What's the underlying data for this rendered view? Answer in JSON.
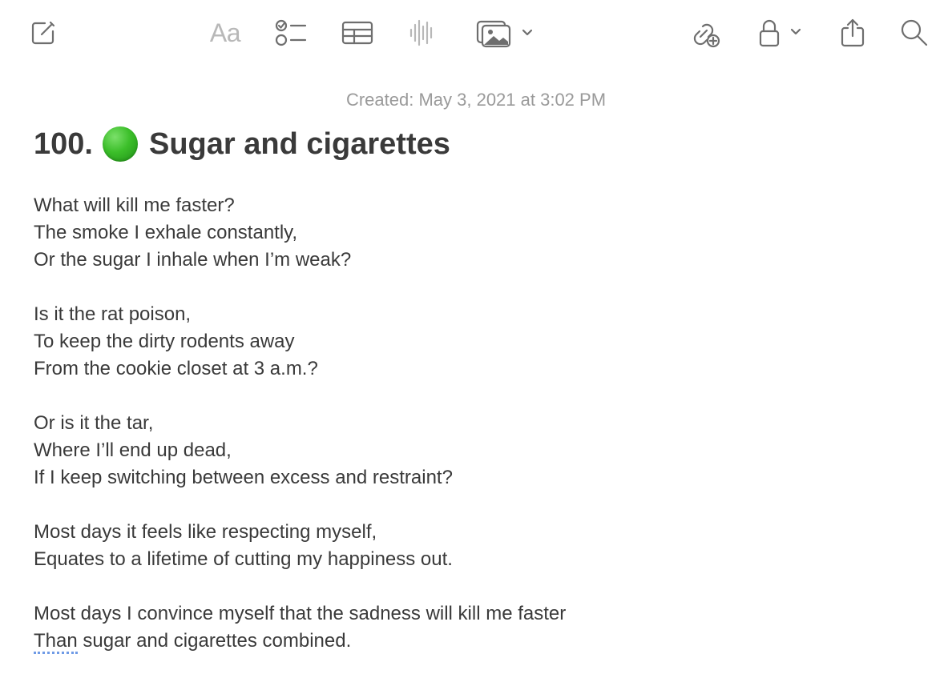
{
  "toolbar": {
    "items": [
      {
        "name": "compose-button",
        "icon": "compose-icon"
      },
      {
        "name": "format-button",
        "label": "Aa",
        "icon": "text-format-icon"
      },
      {
        "name": "checklist-button",
        "icon": "checklist-icon"
      },
      {
        "name": "table-button",
        "icon": "table-icon"
      },
      {
        "name": "audio-button",
        "icon": "waveform-icon"
      },
      {
        "name": "media-button",
        "icon": "photo-icon"
      },
      {
        "name": "collaborate-button",
        "icon": "link-add-icon"
      },
      {
        "name": "lock-button",
        "icon": "lock-icon"
      },
      {
        "name": "share-button",
        "icon": "share-icon"
      },
      {
        "name": "search-button",
        "icon": "search-icon"
      }
    ],
    "format_label": "Aa"
  },
  "note": {
    "created": "Created: May 3, 2021 at 3:02 PM",
    "title_number": "100.",
    "title_emoji": "green-circle",
    "title_text": "Sugar and cigarettes",
    "stanzas": [
      [
        "What will kill me faster?",
        "The smoke I exhale constantly,",
        "Or the sugar I inhale when I’m weak?"
      ],
      [
        "Is it the rat poison,",
        "To keep the dirty rodents away",
        "From the cookie closet at 3 a.m.?"
      ],
      [
        "Or is it the tar,",
        "Where I’ll end up dead,",
        "If I keep switching between excess and restraint?"
      ],
      [
        "Most days it feels like respecting myself,",
        "Equates to a lifetime of cutting my happiness out."
      ],
      [
        "Most days I convince myself that the sadness will kill me faster"
      ]
    ],
    "last_line_misspelled_word": "Than",
    "last_line_rest": " sugar and cigarettes combined."
  },
  "colors": {
    "title_dot": "#3cbf2a",
    "spellcheck_underline": "#6f9be6",
    "created_text": "#9a9a9a",
    "body_text": "#3a3a3a"
  }
}
